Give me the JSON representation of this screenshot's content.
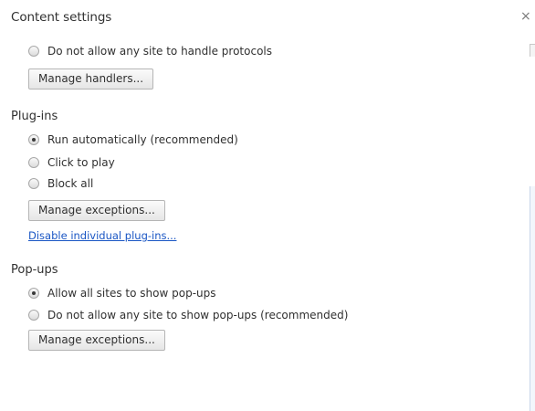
{
  "dialog": {
    "title": "Content settings",
    "close_glyph": "×"
  },
  "handlers": {
    "option_deny": "Do not allow any site to handle protocols",
    "manage_button": "Manage handlers..."
  },
  "plugins": {
    "heading": "Plug-ins",
    "options": [
      {
        "label": "Run automatically (recommended)",
        "checked": true
      },
      {
        "label": "Click to play",
        "checked": false
      },
      {
        "label": "Block all",
        "checked": false
      }
    ],
    "manage_button": "Manage exceptions...",
    "disable_link": "Disable individual plug-ins..."
  },
  "popups": {
    "heading": "Pop-ups",
    "options": [
      {
        "label": "Allow all sites to show pop-ups",
        "checked": true
      },
      {
        "label": "Do not allow any site to show pop-ups (recommended)",
        "checked": false
      }
    ],
    "manage_button": "Manage exceptions..."
  },
  "colors": {
    "link": "#1a56c4",
    "text": "#303030"
  }
}
